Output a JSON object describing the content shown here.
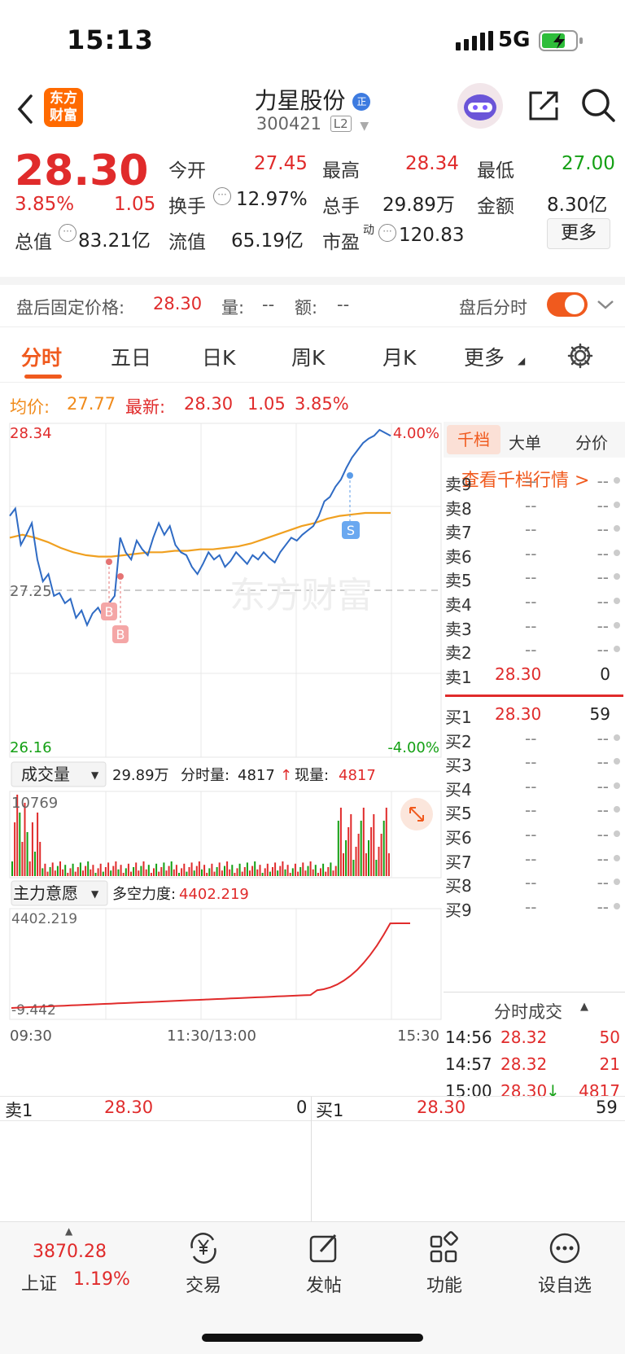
{
  "status_bar": {
    "time": "15:13",
    "network": "5G"
  },
  "header": {
    "logo_line1": "东方",
    "logo_line2": "财富",
    "stock_name": "力星股份",
    "stock_code": "300421",
    "level_badge": "L2",
    "name_badge": "正"
  },
  "quote": {
    "price": "28.30",
    "change_pct": "3.85%",
    "change": "1.05",
    "open_label": "今开",
    "open": "27.45",
    "high_label": "最高",
    "high": "28.34",
    "low_label": "最低",
    "low": "27.00",
    "turnover_label": "换手",
    "turnover": "12.97%",
    "volume_label": "总手",
    "volume": "29.89万",
    "amount_label": "金额",
    "amount": "8.30亿",
    "mktcap_label": "总值",
    "mktcap": "83.21亿",
    "float_label": "流值",
    "float_cap": "65.19亿",
    "pe_label": "市盈",
    "pe_sup": "动",
    "pe": "120.83",
    "more_button": "更多"
  },
  "after_hours": {
    "price_label": "盘后固定价格:",
    "price": "28.30",
    "vol_label": "量:",
    "vol": "--",
    "amt_label": "额:",
    "amt": "--",
    "toggle_label": "盘后分时",
    "toggle_on": true
  },
  "tabs": [
    "分时",
    "五日",
    "日K",
    "周K",
    "月K",
    "更多"
  ],
  "active_tab": 0,
  "legend": {
    "avg_label": "均价:",
    "avg": "27.77",
    "latest_label": "最新:",
    "latest": "28.30",
    "chg": "1.05",
    "chg_pct": "3.85%"
  },
  "chart_labels": {
    "top_price": "28.34",
    "top_pct": "4.00%",
    "mid_price": "27.25",
    "bottom_price": "26.16",
    "bottom_pct": "-4.00%",
    "watermark": "东方财富",
    "vol_selector": "成交量",
    "vol_total": "29.89万",
    "vol_tick_label": "分时量:",
    "vol_tick": "4817",
    "vol_now_label": "现量:",
    "vol_now": "4817",
    "vol_max": "10769",
    "ind_selector": "主力意愿",
    "ind_label": "多空力度:",
    "ind_value": "4402.219",
    "ind_max": "4402.219",
    "ind_min": "-9.442",
    "t_start": "09:30",
    "t_mid": "11:30/13:00",
    "t_end": "15:30",
    "marker_b": "B",
    "marker_s": "S"
  },
  "chart_data": {
    "type": "line",
    "y_range": [
      26.16,
      28.34
    ],
    "series": [
      {
        "name": "价格",
        "color": "#2f6bc4",
        "values": [
          27.75,
          27.8,
          27.55,
          27.62,
          27.7,
          27.45,
          27.3,
          27.35,
          27.2,
          27.22,
          27.15,
          27.18,
          27.05,
          27.1,
          27.0,
          27.08,
          27.12,
          27.05,
          27.15,
          27.2,
          27.6,
          27.5,
          27.45,
          27.58,
          27.52,
          27.48,
          27.6,
          27.7,
          27.62,
          27.68,
          27.55,
          27.5,
          27.48,
          27.4,
          27.35,
          27.42,
          27.5,
          27.45,
          27.48,
          27.4,
          27.44,
          27.5,
          27.46,
          27.42,
          27.48,
          27.45,
          27.5,
          27.46,
          27.43,
          27.5,
          27.55,
          27.6,
          27.58,
          27.62,
          27.65,
          27.68,
          27.75,
          27.85,
          27.88,
          27.95,
          28.0,
          28.08,
          28.15,
          28.2,
          28.25,
          28.28,
          28.3,
          28.34,
          28.32,
          28.3
        ]
      },
      {
        "name": "均价",
        "color": "#f0a020",
        "values": [
          27.6,
          27.62,
          27.6,
          27.57,
          27.53,
          27.5,
          27.48,
          27.47,
          27.47,
          27.48,
          27.49,
          27.5,
          27.5,
          27.51,
          27.51,
          27.52,
          27.52,
          27.53,
          27.54,
          27.56,
          27.59,
          27.62,
          27.65,
          27.68,
          27.7,
          27.73,
          27.75,
          27.76,
          27.77,
          27.77,
          27.77
        ]
      }
    ],
    "volume_max": 10769,
    "indicator_range": [
      -9.442,
      4402.219
    ]
  },
  "orderbook": {
    "tabs": [
      "千档",
      "大单",
      "分价"
    ],
    "link": "查看千档行情 >",
    "asks": [
      {
        "label": "卖9",
        "price": "--",
        "vol": "--"
      },
      {
        "label": "卖8",
        "price": "--",
        "vol": "--"
      },
      {
        "label": "卖7",
        "price": "--",
        "vol": "--"
      },
      {
        "label": "卖6",
        "price": "--",
        "vol": "--"
      },
      {
        "label": "卖5",
        "price": "--",
        "vol": "--"
      },
      {
        "label": "卖4",
        "price": "--",
        "vol": "--"
      },
      {
        "label": "卖3",
        "price": "--",
        "vol": "--"
      },
      {
        "label": "卖2",
        "price": "--",
        "vol": "--"
      },
      {
        "label": "卖1",
        "price": "28.30",
        "vol": "0"
      }
    ],
    "bids": [
      {
        "label": "买1",
        "price": "28.30",
        "vol": "59"
      },
      {
        "label": "买2",
        "price": "--",
        "vol": "--"
      },
      {
        "label": "买3",
        "price": "--",
        "vol": "--"
      },
      {
        "label": "买4",
        "price": "--",
        "vol": "--"
      },
      {
        "label": "买5",
        "price": "--",
        "vol": "--"
      },
      {
        "label": "买6",
        "price": "--",
        "vol": "--"
      },
      {
        "label": "买7",
        "price": "--",
        "vol": "--"
      },
      {
        "label": "买8",
        "price": "--",
        "vol": "--"
      },
      {
        "label": "买9",
        "price": "--",
        "vol": "--"
      }
    ]
  },
  "ticks": {
    "title": "分时成交",
    "rows": [
      {
        "time": "14:56",
        "price": "28.32",
        "vol": "50",
        "dir": ""
      },
      {
        "time": "14:57",
        "price": "28.32",
        "vol": "21",
        "dir": ""
      },
      {
        "time": "15:00",
        "price": "28.30",
        "vol": "4817",
        "dir": "↓"
      }
    ]
  },
  "bottom_book": {
    "sell_label": "卖1",
    "sell_price": "28.30",
    "sell_vol": "0",
    "buy_label": "买1",
    "buy_price": "28.30",
    "buy_vol": "59"
  },
  "nav": {
    "index_value": "3870.28",
    "index_name": "上证",
    "index_pct": "1.19%",
    "items": [
      "交易",
      "发帖",
      "功能",
      "设自选"
    ]
  }
}
